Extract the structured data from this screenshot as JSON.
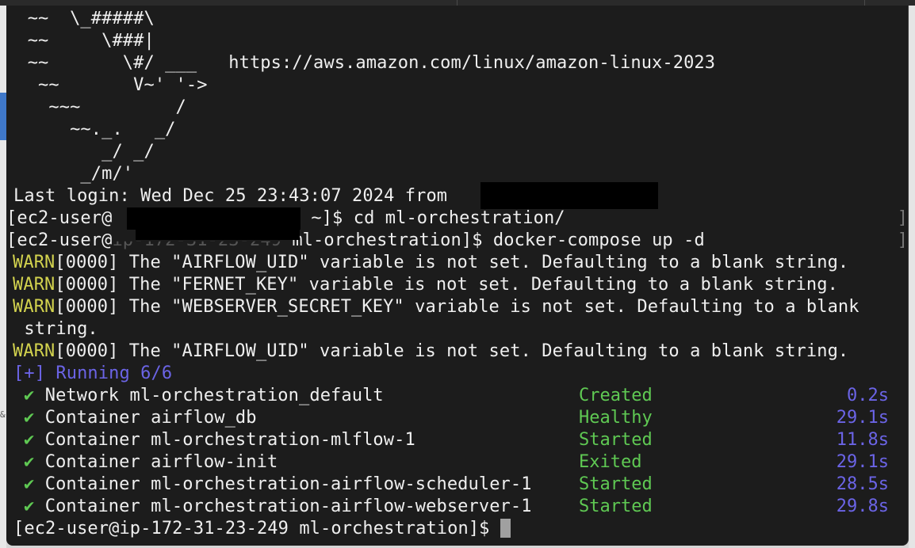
{
  "banner": [
    "  ~~  \\_#####\\",
    "  ~~     \\###|",
    "  ~~       \\#/ ___   https://aws.amazon.com/linux/amazon-linux-2023",
    "   ~~       V~' '->",
    "    ~~~         /",
    "      ~~._.   _/",
    "         _/ _/",
    "       _/m/'"
  ],
  "last_login": "Last login: Wed Dec 25 23:43:07 2024 from ",
  "prompt1": {
    "prefix": "[ec2-user@",
    "suffix": " ~]$ cd ml-orchestration/"
  },
  "prompt2": {
    "prefix": "[ec2-user@",
    "middle": "ip-172-31-23-249",
    "suffix": " ml-orchestration]$ docker-compose up -d"
  },
  "warnings": [
    {
      "tag": "WARN",
      "text": "[0000] The \"AIRFLOW_UID\" variable is not set. Defaulting to a blank string."
    },
    {
      "tag": "WARN",
      "text": "[0000] The \"FERNET_KEY\" variable is not set. Defaulting to a blank string."
    },
    {
      "tag": "WARN",
      "text": "[0000] The \"WEBSERVER_SECRET_KEY\" variable is not set. Defaulting to a blank"
    },
    {
      "tag": "WARN",
      "text": "[0000] The \"AIRFLOW_UID\" variable is not set. Defaulting to a blank string."
    }
  ],
  "wrap_continuation": " string.",
  "running": "[+] Running 6/6",
  "check_mark": "✔",
  "services": [
    {
      "name": "Network ml-orchestration_default",
      "status": "Created",
      "time": "0.2s"
    },
    {
      "name": "Container airflow_db",
      "status": "Healthy",
      "time": "29.1s"
    },
    {
      "name": "Container ml-orchestration-mlflow-1",
      "status": "Started",
      "time": "11.8s"
    },
    {
      "name": "Container airflow-init",
      "status": "Exited",
      "time": "29.1s"
    },
    {
      "name": "Container ml-orchestration-airflow-scheduler-1",
      "status": "Started",
      "time": "28.5s"
    },
    {
      "name": "Container ml-orchestration-airflow-webserver-1",
      "status": "Started",
      "time": "29.8s"
    }
  ],
  "final_prompt": "[ec2-user@ip-172-31-23-249 ml-orchestration]$ ",
  "colors": {
    "background": "#1c1c1c",
    "text": "#efefef",
    "warn": "#d2d24e",
    "running": "#6b64e6",
    "success": "#5fc953"
  }
}
